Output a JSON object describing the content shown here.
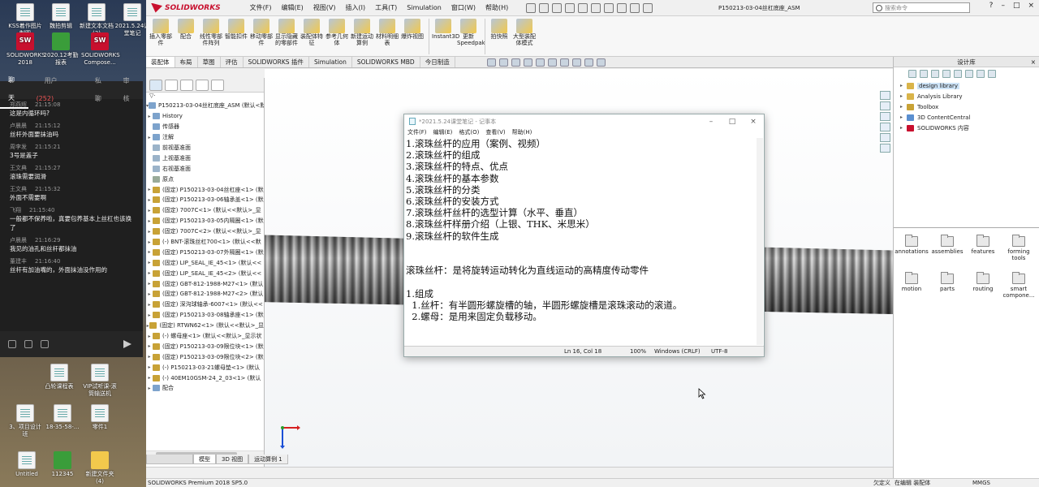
{
  "desktop": {
    "icons_top": [
      {
        "label": "KSS着作图片制图",
        "icon": "doc-icon"
      },
      {
        "label": "魏拍剪辑",
        "icon": "app-icon"
      },
      {
        "label": "新建文本文档 (3)",
        "icon": "doc-icon"
      },
      {
        "label": "2021.5.24课堂笔记",
        "icon": "doc-icon"
      }
    ],
    "icons_row2": [
      {
        "label": "SOLIDWORKS 2018",
        "icon": "solidworks-icon"
      },
      {
        "label": "2020.12考勤报表",
        "icon": "excel-icon"
      },
      {
        "label": "SOLIDWORKS Compose...",
        "icon": "solidworks-icon"
      }
    ],
    "icons_mid": [
      {
        "label": "凸轮课程表",
        "icon": "app-icon"
      },
      {
        "label": "VIP试听课-滚筒输送机",
        "icon": "app-icon"
      }
    ],
    "icons_row4": [
      {
        "label": "3、项目设计班",
        "icon": "doc-icon"
      },
      {
        "label": "18-35-58-...",
        "icon": "app-icon"
      },
      {
        "label": "零件1",
        "icon": "part-icon"
      }
    ],
    "icons_bottom": [
      {
        "label": "Untitled",
        "icon": "app-icon"
      },
      {
        "label": "112345",
        "icon": "excel-icon"
      },
      {
        "label": "新建文件夹 (4)",
        "icon": "folder-icon"
      }
    ]
  },
  "chat": {
    "tab_chat": "聊天",
    "tab_users": "用户",
    "user_count": "(252)",
    "tab_private": "私聊",
    "tab_review": "审核",
    "messages": [
      {
        "name": "郑燕辉",
        "time": "21:15:08",
        "text": "这是内循环吗?"
      },
      {
        "name": "卢晨晨",
        "time": "21:15:12",
        "text": "丝杆外面要抹油吗"
      },
      {
        "name": "周李发",
        "time": "21:15:21",
        "text": "3号是盖子"
      },
      {
        "name": "王文典",
        "time": "21:15:27",
        "text": "滚珠需要润滑"
      },
      {
        "name": "王文典",
        "time": "21:15:32",
        "text": "外面不需要啊"
      },
      {
        "name": "飞翔",
        "time": "21:15:40",
        "text": "一般都不保养啦，真要包养基本上丝杠也该换了"
      },
      {
        "name": "卢晨晨",
        "time": "21:16:29",
        "text": "我见的油孔和丝杆都抹油"
      },
      {
        "name": "董建丰",
        "time": "21:16:40",
        "text": "丝杆有加油嘴的，外面抹油没作用的"
      }
    ]
  },
  "app": {
    "logo": "SOLIDWORKS",
    "menus": [
      "文件(F)",
      "编辑(E)",
      "视图(V)",
      "插入(I)",
      "工具(T)",
      "Simulation",
      "窗口(W)",
      "帮助(H)"
    ],
    "doc_title": "P150213-03-04丝杠底座_ASM",
    "search_placeholder": "搜索命令",
    "window_buttons": [
      "?",
      "–",
      "□",
      "×"
    ]
  },
  "commands": [
    {
      "label": "插入零部件",
      "icon": "insert-component-icon"
    },
    {
      "label": "配合",
      "icon": "mate-icon"
    },
    {
      "label": "线性零部件阵列",
      "icon": "linear-pattern-icon"
    },
    {
      "label": "智能扣件",
      "icon": "smart-fasteners-icon"
    },
    {
      "label": "移动零部件",
      "icon": "move-component-icon"
    },
    {
      "label": "显示隐藏的零部件",
      "icon": "show-hidden-icon"
    },
    {
      "label": "装配体特征",
      "icon": "assembly-features-icon"
    },
    {
      "label": "参考几何体",
      "icon": "reference-geometry-icon"
    },
    {
      "label": "新建运动算例",
      "icon": "motion-study-icon"
    },
    {
      "label": "材料明细表",
      "icon": "bom-icon"
    },
    {
      "label": "爆炸视图",
      "icon": "exploded-view-icon"
    },
    {
      "label": "Instant3D",
      "icon": "instant3d-icon"
    },
    {
      "label": "更新Speedpak",
      "icon": "speedpak-icon"
    },
    {
      "label": "拍快照",
      "icon": "snapshot-icon"
    },
    {
      "label": "大型装配体模式",
      "icon": "large-assembly-icon"
    }
  ],
  "command_tabs": [
    "装配体",
    "布局",
    "草图",
    "评估",
    "SOLIDWORKS 插件",
    "Simulation",
    "SOLIDWORKS MBD",
    "今日制造"
  ],
  "tree": {
    "filter": "▽·",
    "root": "P150213-03-04丝杠底座_ASM (默认<默",
    "items": [
      {
        "ex": "▸",
        "label": "History",
        "kind": "b"
      },
      {
        "ex": "",
        "label": "传感器",
        "kind": "b"
      },
      {
        "ex": "▸",
        "label": "注解",
        "kind": "b"
      },
      {
        "ex": "",
        "label": "前视基准面",
        "kind": "p"
      },
      {
        "ex": "",
        "label": "上视基准面",
        "kind": "p"
      },
      {
        "ex": "",
        "label": "右视基准面",
        "kind": "p"
      },
      {
        "ex": "",
        "label": "原点",
        "kind": "g"
      },
      {
        "ex": "▸",
        "label": "(固定) P150213-03-04丝杠座<1> (默",
        "kind": "y"
      },
      {
        "ex": "▸",
        "label": "(固定) P150213-03-06轴承盖<1> (默",
        "kind": "y"
      },
      {
        "ex": "▸",
        "label": "(固定) 7007C<1> (默认<<默认>_显",
        "kind": "y"
      },
      {
        "ex": "▸",
        "label": "(固定) P150213-03-05内隔圈<1> (默",
        "kind": "y"
      },
      {
        "ex": "▸",
        "label": "(固定) 7007C<2> (默认<<默认>_显",
        "kind": "y"
      },
      {
        "ex": "▸",
        "label": "(-) BNT-滚珠丝杠700<1> (默认<<默",
        "kind": "y"
      },
      {
        "ex": "▸",
        "label": "(固定) P150213-03-07外隔圈<1> (默",
        "kind": "y"
      },
      {
        "ex": "▸",
        "label": "(固定) LIP_SEAL_IE_45<1> (默认<<",
        "kind": "y"
      },
      {
        "ex": "▸",
        "label": "(固定) LIP_SEAL_IE_45<2> (默认<<",
        "kind": "y"
      },
      {
        "ex": "▸",
        "label": "(固定) GBT-812-1988-M27<1> (默认",
        "kind": "y"
      },
      {
        "ex": "▸",
        "label": "(固定) GBT-812-1988-M27<2> (默认",
        "kind": "y"
      },
      {
        "ex": "▸",
        "label": "(固定) 深沟球轴承-6007<1> (默认<<",
        "kind": "y"
      },
      {
        "ex": "▸",
        "label": "(固定) P150213-03-08轴承座<1> (默",
        "kind": "y"
      },
      {
        "ex": "▸",
        "label": "(固定) RTWN62<1> (默认<<默认>_显",
        "kind": "y"
      },
      {
        "ex": "▸",
        "label": "(-) 螺母座<1> (默认<<默认>_显示状",
        "kind": "y"
      },
      {
        "ex": "▸",
        "label": "(固定) P150213-03-09限位块<1> (默",
        "kind": "y"
      },
      {
        "ex": "▸",
        "label": "(固定) P150213-03-09限位块<2> (默",
        "kind": "y"
      },
      {
        "ex": "▸",
        "label": "(-) P150213-03-21螺母垫<1> (默认",
        "kind": "y"
      },
      {
        "ex": "▸",
        "label": "(-) 40EM10GSM-24_2_03<1> (默认",
        "kind": "y"
      },
      {
        "ex": "▸",
        "label": "配合",
        "kind": "b"
      }
    ]
  },
  "bottom_tabs": [
    "模型",
    "3D 视图",
    "运动算例 1"
  ],
  "statusbar": {
    "left": "SOLIDWORKS Premium 2018 SP5.0",
    "mid": "欠定义",
    "mid2": "在编辑 装配体",
    "units": "MMGS"
  },
  "design_library": {
    "title": "设计库",
    "close": "×",
    "tree": [
      {
        "label": "design library",
        "color": "#d9b44a",
        "selected": true
      },
      {
        "label": "Analysis Library",
        "color": "#d9b44a",
        "selected": false
      },
      {
        "label": "Toolbox",
        "color": "#c8a236",
        "selected": false
      },
      {
        "label": "3D ContentCentral",
        "color": "#5a8fd0",
        "selected": false
      },
      {
        "label": "SOLIDWORKS 内容",
        "color": "#c8102e",
        "selected": false
      }
    ],
    "folders": [
      "annotations",
      "assemblies",
      "features",
      "forming tools",
      "motion",
      "parts",
      "routing",
      "smart compone..."
    ]
  },
  "notepad": {
    "title": "*2021.5.24课堂笔记 - 记事本",
    "menus": [
      "文件(F)",
      "编辑(E)",
      "格式(O)",
      "查看(V)",
      "帮助(H)"
    ],
    "lines": [
      "1.滚珠丝杆的应用（案例、视频）",
      "2.滚珠丝杆的组成",
      "3.滚珠丝杆的特点、优点",
      "4.滚珠丝杆的基本参数",
      "5.滚珠丝杆的分类",
      "6.滚珠丝杆的安装方式",
      "7.滚珠丝杆丝杆的选型计算（水平、垂直）",
      "8.滚珠丝杆样册介绍（上银、THK、米思米）",
      "9.滚珠丝杆的软件生成",
      "",
      "",
      "滚珠丝杆：是将旋转运动转化为直线运动的高精度传动零件",
      "",
      "1.组成",
      "  1.丝杆：有半圆形螺旋槽的轴，半圆形螺旋槽是滚珠滚动的滚道。",
      "  2.螺母：是用来固定负载移动。"
    ],
    "position": "Ln 16, Col 18",
    "zoom": "100%",
    "eol": "Windows (CRLF)",
    "encoding": "UTF-8"
  }
}
